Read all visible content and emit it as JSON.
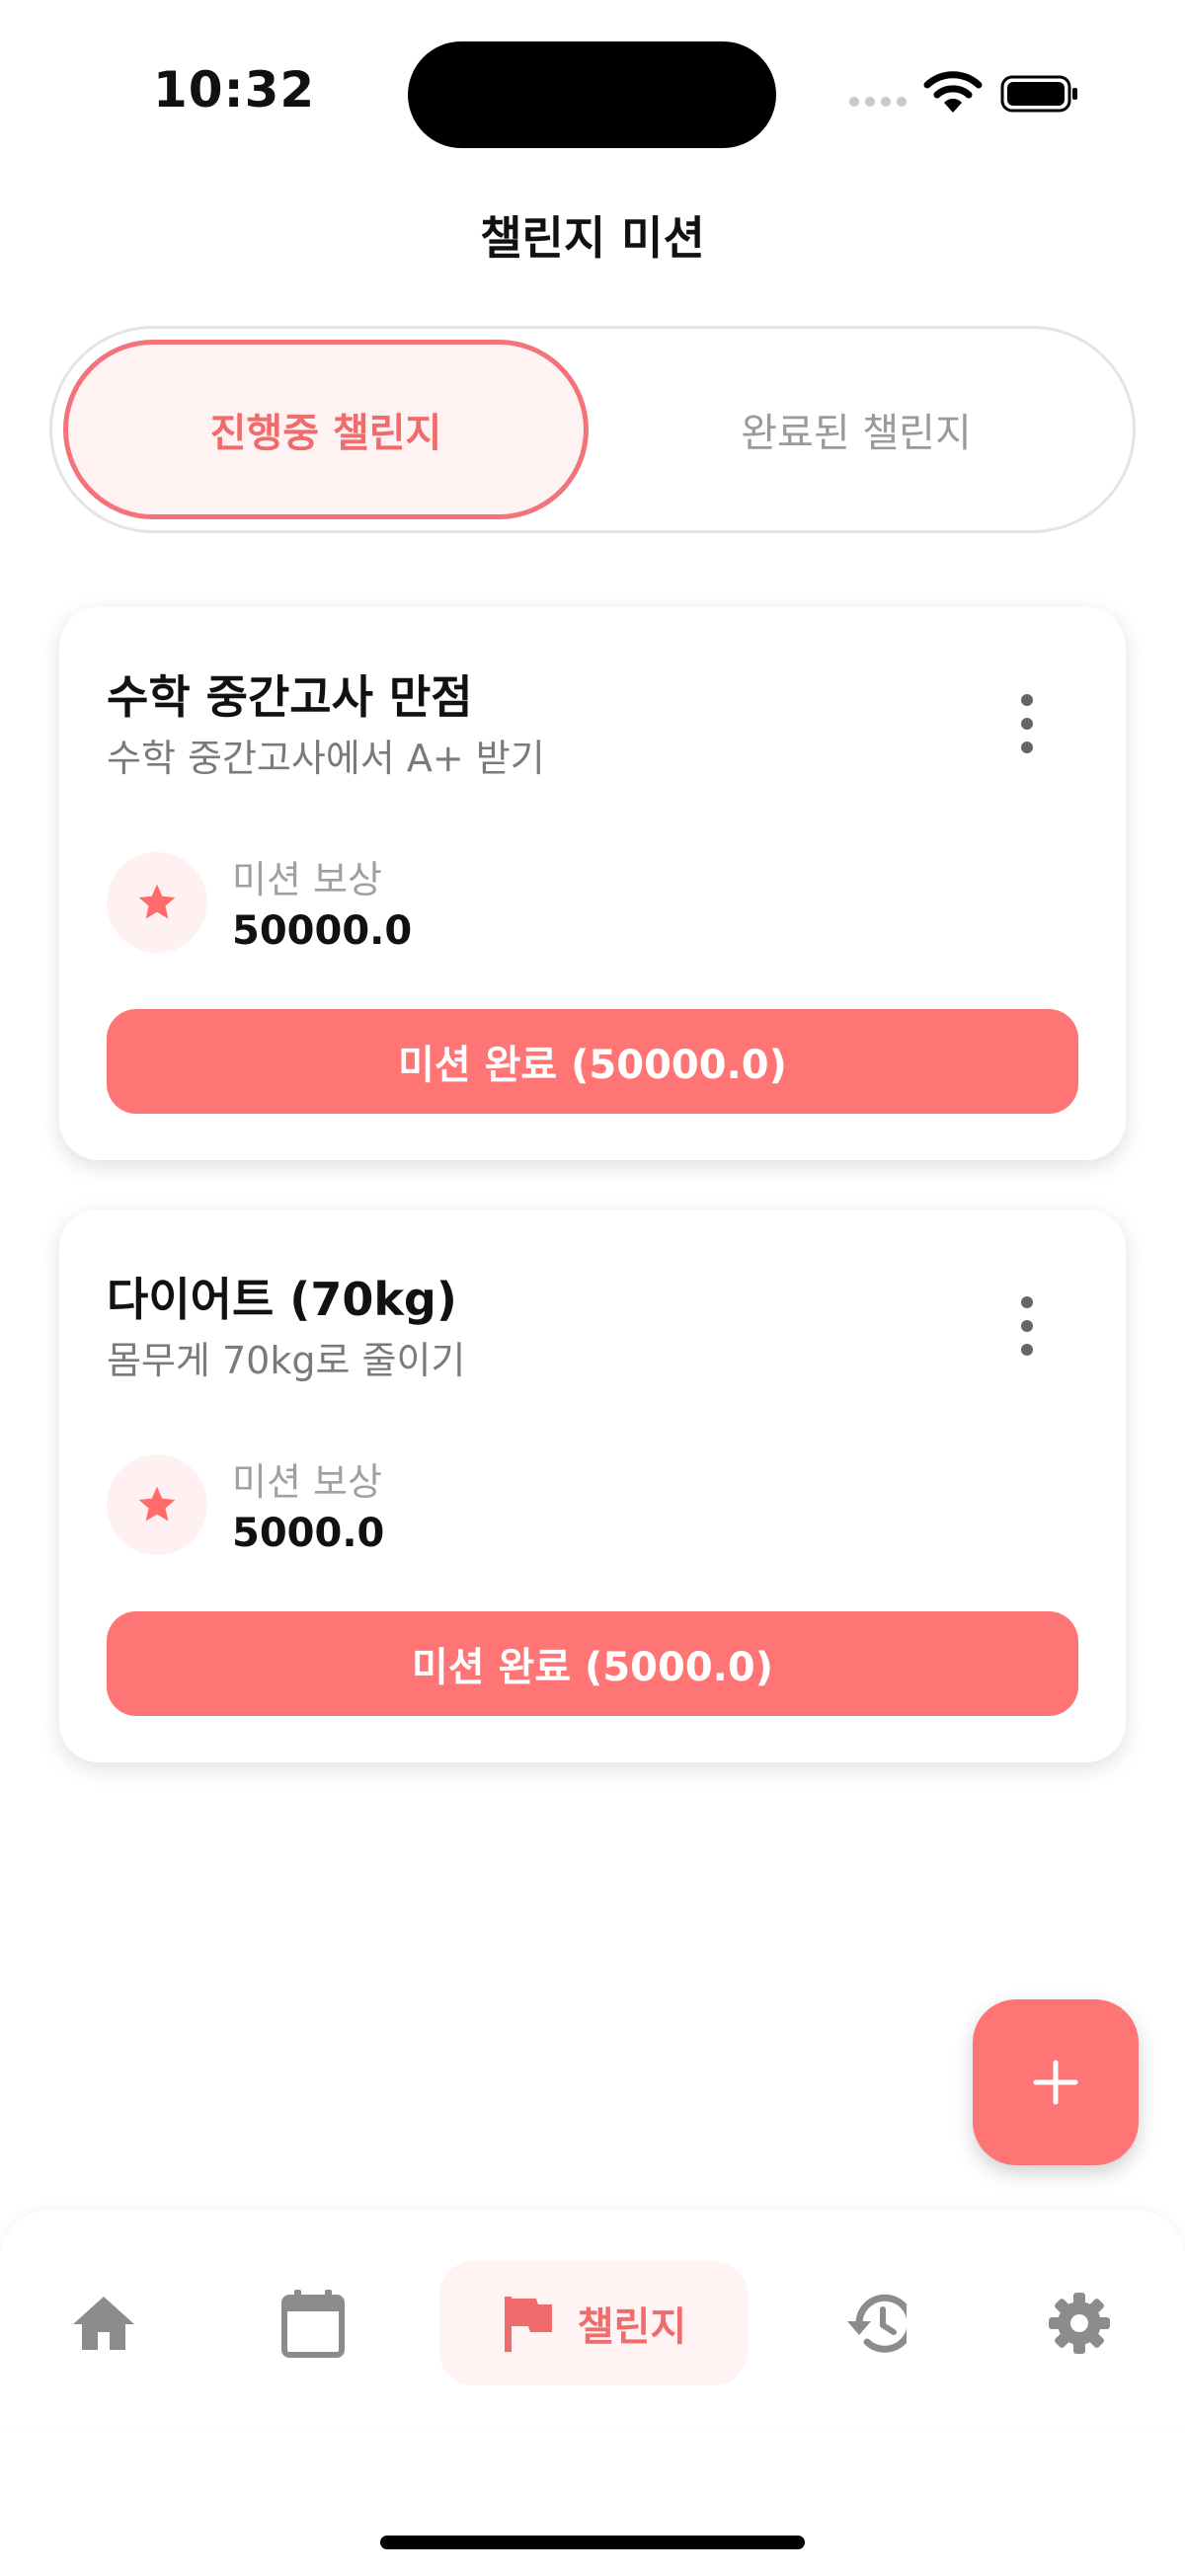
{
  "status_bar": {
    "time": "10:32"
  },
  "header": {
    "title": "챌린지 미션"
  },
  "tabs": [
    {
      "label": "진행중 챌린지",
      "active": true
    },
    {
      "label": "완료된 챌린지",
      "active": false
    }
  ],
  "challenges": [
    {
      "title": "수학 중간고사 만점",
      "description": "수학 중간고사에서 A+ 받기",
      "reward_label": "미션 보상",
      "reward_value": "50000.0",
      "complete_label": "미션 완료 (50000.0)"
    },
    {
      "title": "다이어트 (70kg)",
      "description": "몸무게 70kg로 줄이기",
      "reward_label": "미션 보상",
      "reward_value": "5000.0",
      "complete_label": "미션 완료 (5000.0)"
    }
  ],
  "fab": {
    "icon": "plus-icon"
  },
  "bottom_nav": {
    "items": [
      {
        "icon": "home-icon"
      },
      {
        "icon": "calendar-icon"
      },
      {
        "icon": "flag-icon",
        "label": "챌린지",
        "active": true
      },
      {
        "icon": "history-icon"
      },
      {
        "icon": "gear-icon"
      }
    ]
  },
  "colors": {
    "accent": "#ff7575",
    "accent_text": "#f06b6b",
    "accent_light": "#fff2f2",
    "icon_gray": "#8c8c8c"
  }
}
